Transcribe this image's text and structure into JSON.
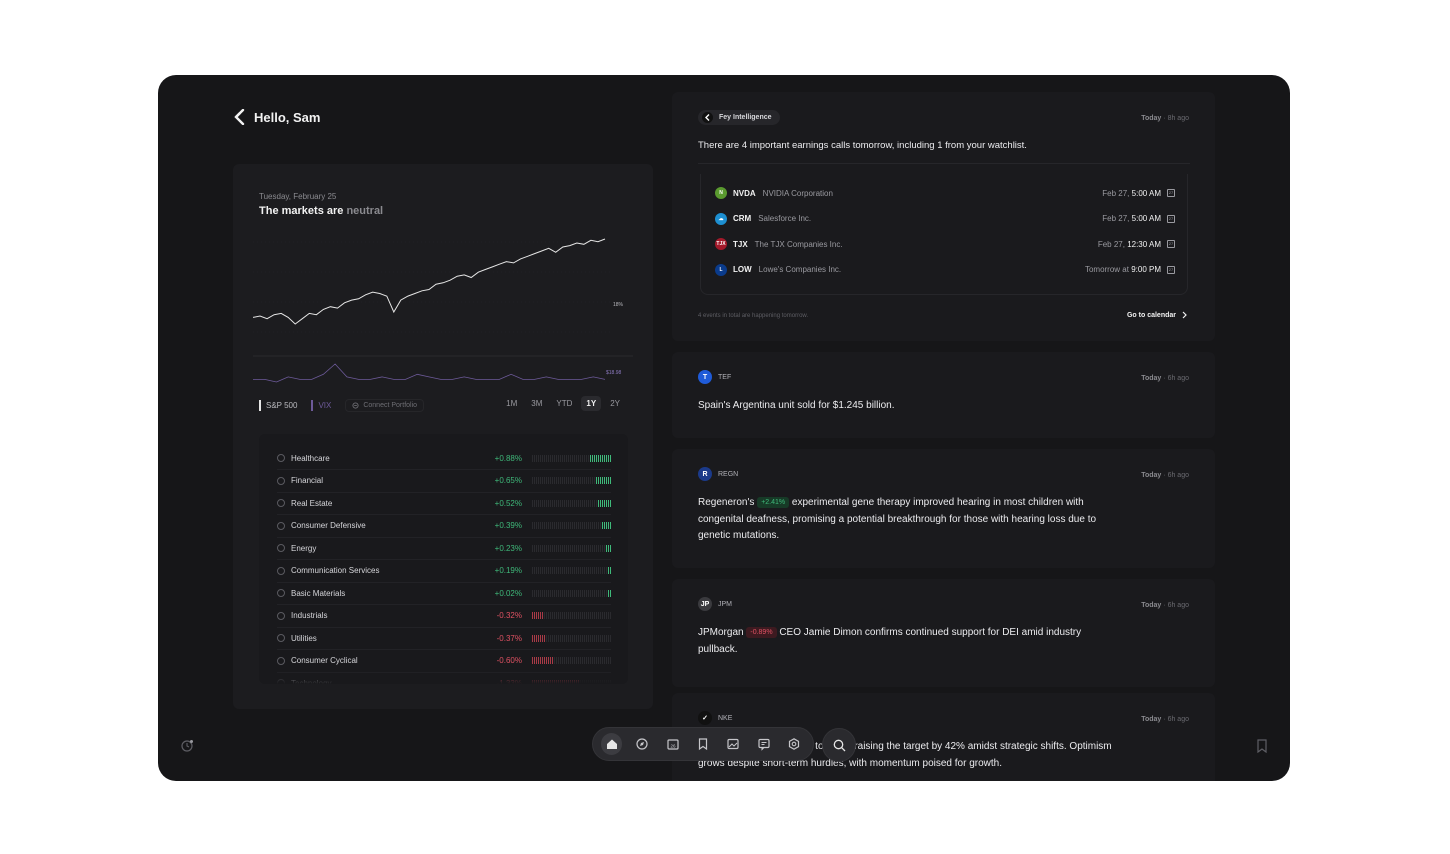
{
  "header": {
    "greeting": "Hello, Sam"
  },
  "market": {
    "date": "Tuesday, February 25",
    "headline_prefix": "The markets are ",
    "headline_status": "neutral",
    "sp500_end_label": "18%",
    "vix_end_label": "$18.98",
    "legend": {
      "sp500": "S&P 500",
      "vix": "VIX",
      "connect": "Connect Portfolio"
    },
    "ranges": [
      "1M",
      "3M",
      "YTD",
      "1Y",
      "2Y"
    ],
    "active_range": "1Y"
  },
  "chart_data": {
    "type": "line",
    "series": [
      {
        "name": "S&P 500",
        "values": [
          2,
          3,
          1,
          4,
          5,
          2,
          -3,
          1,
          5,
          4,
          8,
          10,
          9,
          13,
          15,
          16,
          19,
          21,
          20,
          18,
          6,
          15,
          18,
          20,
          22,
          23,
          27,
          28,
          30,
          33,
          34,
          32,
          36,
          38,
          40,
          42,
          44,
          43,
          46,
          48,
          50,
          52,
          54,
          51,
          55,
          56,
          58,
          57,
          60,
          59,
          61
        ]
      },
      {
        "name": "VIX",
        "values": [
          3,
          3,
          2,
          4,
          3,
          3,
          5,
          9,
          4,
          3,
          3,
          4,
          3,
          3,
          5,
          4,
          3,
          3,
          4,
          3,
          3,
          3,
          5,
          3,
          3,
          4,
          3,
          3,
          3,
          4,
          3
        ]
      }
    ],
    "color_sp500": "#e6e6e6",
    "color_vix": "#6d5a9a"
  },
  "sectors": [
    {
      "name": "Healthcare",
      "change": "+0.88%",
      "dir": "up",
      "level": 0.88
    },
    {
      "name": "Financial",
      "change": "+0.65%",
      "dir": "up",
      "level": 0.65
    },
    {
      "name": "Real Estate",
      "change": "+0.52%",
      "dir": "up",
      "level": 0.52
    },
    {
      "name": "Consumer Defensive",
      "change": "+0.39%",
      "dir": "up",
      "level": 0.39
    },
    {
      "name": "Energy",
      "change": "+0.23%",
      "dir": "up",
      "level": 0.23
    },
    {
      "name": "Communication Services",
      "change": "+0.19%",
      "dir": "up",
      "level": 0.19
    },
    {
      "name": "Basic Materials",
      "change": "+0.02%",
      "dir": "up",
      "level": 0.02
    },
    {
      "name": "Industrials",
      "change": "-0.32%",
      "dir": "down",
      "level": 0.32
    },
    {
      "name": "Utilities",
      "change": "-0.37%",
      "dir": "down",
      "level": 0.37
    },
    {
      "name": "Consumer Cyclical",
      "change": "-0.60%",
      "dir": "down",
      "level": 0.6
    },
    {
      "name": "Technology",
      "change": "-1.33%",
      "dir": "down",
      "level": 1.33
    }
  ],
  "feed": {
    "fey": {
      "label": "Fey Intelligence",
      "time_day": "Today",
      "time_ago": "8h ago",
      "text": "There are 4 important earnings calls tomorrow, including 1 from your watchlist.",
      "earnings": [
        {
          "ticker": "NVDA",
          "name": "NVIDIA Corporation",
          "date": "Feb 27,",
          "time": "5:00 AM",
          "logo": "N",
          "color": "#5a9a2f"
        },
        {
          "ticker": "CRM",
          "name": "Salesforce Inc.",
          "date": "Feb 27,",
          "time": "5:00 AM",
          "logo": "☁",
          "color": "#1d8fd1"
        },
        {
          "ticker": "TJX",
          "name": "The TJX Companies Inc.",
          "date": "Feb 27,",
          "time": "12:30 AM",
          "logo": "TJX",
          "color": "#a3192a"
        },
        {
          "ticker": "LOW",
          "name": "Lowe's Companies Inc.",
          "date": "Tomorrow at",
          "time": "9:00 PM",
          "logo": "L",
          "color": "#0a3b8c"
        }
      ],
      "footer": "4 events in total are happening tomorrow.",
      "cta": "Go to calendar"
    },
    "news": [
      {
        "ticker": "TEF",
        "logo": "T",
        "logo_color": "#1f5bd8",
        "time_day": "Today",
        "time_ago": "6h ago",
        "pre": "Spain's Argentina unit sold for $1.245 billion.",
        "chip": "",
        "chip_dir": "",
        "post": ""
      },
      {
        "ticker": "REGN",
        "logo": "R",
        "logo_color": "#1b3a8a",
        "time_day": "Today",
        "time_ago": "6h ago",
        "pre": "Regeneron's",
        "chip": "+2.41%",
        "chip_dir": "up",
        "post": "experimental gene therapy improved hearing in most children with congenital deafness, promising a potential breakthrough for those with hearing loss due to genetic mutations."
      },
      {
        "ticker": "JPM",
        "logo": "JP",
        "logo_color": "#3a3a3e",
        "time_day": "Today",
        "time_ago": "6h ago",
        "pre": "JPMorgan",
        "chip": "-0.89%",
        "chip_dir": "down",
        "post": "CEO Jamie Dimon confirms continued support for DEI amid industry pullback."
      },
      {
        "ticker": "NKE",
        "logo": "✓",
        "logo_color": "#111111",
        "time_day": "Today",
        "time_ago": "6h ago",
        "pre": "Je",
        "chip": "",
        "chip_dir": "",
        "post": "upgrades it from \"hold\" to \"buy,\" raising the target by 42% amidst strategic shifts. Optimism grows despite short-term hurdles, with momentum poised for growth."
      }
    ]
  },
  "dock": {
    "items": [
      {
        "icon": "home-icon",
        "active": true
      },
      {
        "icon": "compass-icon",
        "active": false
      },
      {
        "icon": "calendar-icon",
        "active": false
      },
      {
        "icon": "bookmark-icon",
        "active": false
      },
      {
        "icon": "image-icon",
        "active": false
      },
      {
        "icon": "chat-icon",
        "active": false
      },
      {
        "icon": "settings-icon",
        "active": false
      }
    ],
    "calendar_day": "26"
  }
}
